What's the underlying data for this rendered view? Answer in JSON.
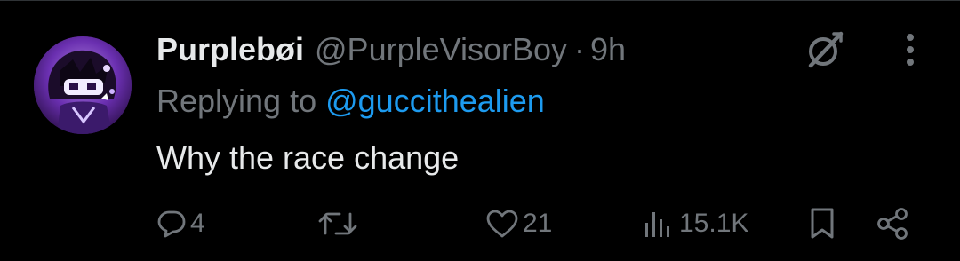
{
  "tweet": {
    "display_name": "Purplebøi",
    "handle": "@PurpleVisorBoy",
    "separator": "·",
    "time": "9h",
    "replying_prefix": "Replying to",
    "replying_to": "@guccithealien",
    "text": "Why the race change"
  },
  "actions": {
    "replies": "4",
    "reposts": "",
    "likes": "21",
    "views": "15.1K"
  },
  "icons": {
    "grok": "grok-icon",
    "more": "more-vertical-icon",
    "reply": "reply-icon",
    "repost": "repost-icon",
    "like": "heart-icon",
    "views": "views-chart-icon",
    "bookmark": "bookmark-icon",
    "share": "share-icon"
  },
  "colors": {
    "background": "#000000",
    "text_primary": "#e7e9ea",
    "text_secondary": "#71767b",
    "accent": "#1d9bf0"
  }
}
